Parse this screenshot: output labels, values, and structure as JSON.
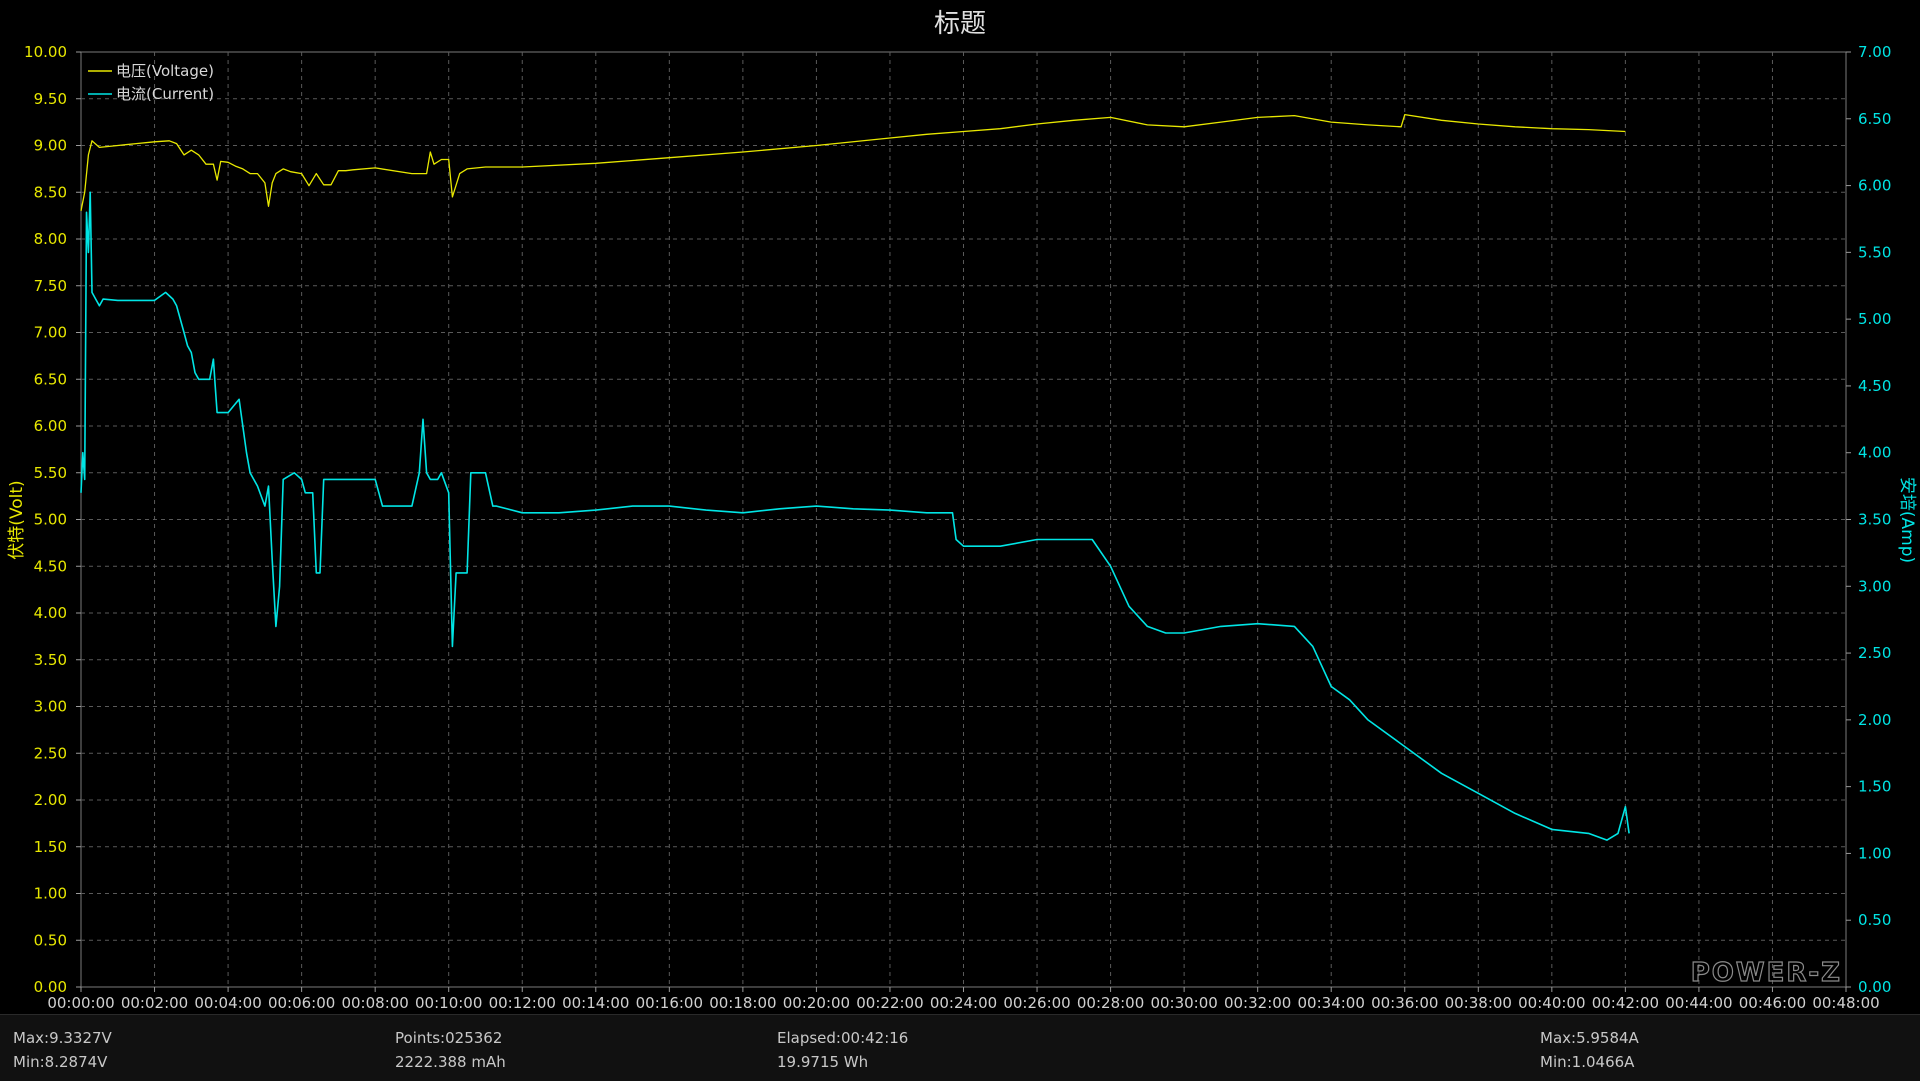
{
  "chart_data": {
    "type": "line",
    "title": "标题",
    "x_label": "",
    "x_range_minutes": [
      0,
      48
    ],
    "x_ticks": [
      "00:00:00",
      "00:02:00",
      "00:04:00",
      "00:06:00",
      "00:08:00",
      "00:10:00",
      "00:12:00",
      "00:14:00",
      "00:16:00",
      "00:18:00",
      "00:20:00",
      "00:22:00",
      "00:24:00",
      "00:26:00",
      "00:28:00",
      "00:30:00",
      "00:32:00",
      "00:34:00",
      "00:36:00",
      "00:38:00",
      "00:40:00",
      "00:42:00",
      "00:44:00",
      "00:46:00",
      "00:48:00"
    ],
    "y_left": {
      "label": "伏特(Volt)",
      "range": [
        0,
        10
      ],
      "ticks": [
        "0.00",
        "0.50",
        "1.00",
        "1.50",
        "2.00",
        "2.50",
        "3.00",
        "3.50",
        "4.00",
        "4.50",
        "5.00",
        "5.50",
        "6.00",
        "6.50",
        "7.00",
        "7.50",
        "8.00",
        "8.50",
        "9.00",
        "9.50",
        "10.00"
      ],
      "color": "#e8e800"
    },
    "y_right": {
      "label": "安培(Amp)",
      "range": [
        0,
        7
      ],
      "ticks": [
        "0.00",
        "0.50",
        "1.00",
        "1.50",
        "2.00",
        "2.50",
        "3.00",
        "3.50",
        "4.00",
        "4.50",
        "5.00",
        "5.50",
        "6.00",
        "6.50",
        "7.00"
      ],
      "color": "#00e5e5"
    },
    "grid": true,
    "legend_position": "top-left",
    "series": [
      {
        "name": "电压(Voltage)",
        "axis": "left",
        "color": "#e8e800",
        "x": [
          0.0,
          0.1,
          0.2,
          0.3,
          0.5,
          1.0,
          1.5,
          2.0,
          2.4,
          2.6,
          2.8,
          3.0,
          3.2,
          3.4,
          3.6,
          3.7,
          3.8,
          4.0,
          4.2,
          4.4,
          4.6,
          4.8,
          5.0,
          5.1,
          5.2,
          5.3,
          5.5,
          5.7,
          6.0,
          6.2,
          6.4,
          6.6,
          6.8,
          7.0,
          7.2,
          7.4,
          8.0,
          9.0,
          9.4,
          9.5,
          9.6,
          9.8,
          10.0,
          10.1,
          10.3,
          10.5,
          11.0,
          12.0,
          14.0,
          16.0,
          18.0,
          20.0,
          22.0,
          23.0,
          24.0,
          25.0,
          26.0,
          27.0,
          28.0,
          29.0,
          30.0,
          31.0,
          32.0,
          33.0,
          34.0,
          35.0,
          35.9,
          36.0,
          37.0,
          38.0,
          39.0,
          40.0,
          41.0,
          42.0
        ],
        "y": [
          8.3,
          8.5,
          8.9,
          9.05,
          8.98,
          9.0,
          9.02,
          9.04,
          9.05,
          9.02,
          8.9,
          8.95,
          8.9,
          8.8,
          8.8,
          8.63,
          8.83,
          8.82,
          8.78,
          8.75,
          8.7,
          8.7,
          8.6,
          8.35,
          8.6,
          8.7,
          8.75,
          8.72,
          8.7,
          8.57,
          8.7,
          8.58,
          8.58,
          8.73,
          8.73,
          8.74,
          8.76,
          8.7,
          8.7,
          8.93,
          8.8,
          8.85,
          8.85,
          8.45,
          8.7,
          8.75,
          8.77,
          8.77,
          8.81,
          8.87,
          8.93,
          9.0,
          9.08,
          9.12,
          9.15,
          9.18,
          9.23,
          9.27,
          9.3,
          9.22,
          9.2,
          9.25,
          9.3,
          9.32,
          9.25,
          9.22,
          9.2,
          9.33,
          9.27,
          9.23,
          9.2,
          9.18,
          9.17,
          9.15
        ]
      },
      {
        "name": "电流(Current)",
        "axis": "right",
        "color": "#00e5e5",
        "x": [
          0.0,
          0.05,
          0.1,
          0.15,
          0.2,
          0.25,
          0.3,
          0.4,
          0.5,
          0.6,
          1.0,
          1.5,
          2.0,
          2.3,
          2.5,
          2.6,
          2.8,
          2.9,
          3.0,
          3.1,
          3.2,
          3.5,
          3.6,
          3.65,
          3.7,
          3.8,
          4.0,
          4.3,
          4.5,
          4.6,
          4.8,
          5.0,
          5.1,
          5.2,
          5.3,
          5.4,
          5.5,
          5.8,
          6.0,
          6.1,
          6.3,
          6.4,
          6.5,
          6.6,
          6.8,
          7.0,
          7.5,
          8.0,
          8.2,
          8.3,
          8.5,
          9.0,
          9.2,
          9.3,
          9.4,
          9.5,
          9.7,
          9.8,
          10.0,
          10.1,
          10.2,
          10.3,
          10.5,
          10.6,
          10.8,
          11.0,
          11.2,
          11.3,
          12.0,
          13.0,
          14.0,
          15.0,
          16.0,
          17.0,
          18.0,
          19.0,
          20.0,
          21.0,
          22.0,
          23.0,
          23.7,
          23.8,
          24.0,
          25.0,
          26.0,
          27.0,
          27.5,
          28.0,
          28.5,
          29.0,
          29.5,
          30.0,
          31.0,
          32.0,
          33.0,
          33.5,
          34.0,
          34.5,
          35.0,
          36.0,
          37.0,
          38.0,
          39.0,
          40.0,
          41.0,
          41.5,
          41.8,
          42.0,
          42.1
        ],
        "y": [
          3.7,
          4.0,
          3.8,
          5.8,
          5.5,
          5.95,
          5.2,
          5.15,
          5.1,
          5.15,
          5.14,
          5.14,
          5.14,
          5.2,
          5.15,
          5.1,
          4.9,
          4.8,
          4.75,
          4.6,
          4.55,
          4.55,
          4.7,
          4.5,
          4.3,
          4.3,
          4.3,
          4.4,
          4.0,
          3.85,
          3.75,
          3.6,
          3.75,
          3.2,
          2.7,
          3.0,
          3.8,
          3.85,
          3.8,
          3.7,
          3.7,
          3.1,
          3.1,
          3.8,
          3.8,
          3.8,
          3.8,
          3.8,
          3.6,
          3.6,
          3.6,
          3.6,
          3.85,
          4.25,
          3.85,
          3.8,
          3.8,
          3.85,
          3.7,
          2.55,
          3.1,
          3.1,
          3.1,
          3.85,
          3.85,
          3.85,
          3.6,
          3.6,
          3.55,
          3.55,
          3.57,
          3.6,
          3.6,
          3.57,
          3.55,
          3.58,
          3.6,
          3.58,
          3.57,
          3.55,
          3.55,
          3.35,
          3.3,
          3.3,
          3.35,
          3.35,
          3.35,
          3.15,
          2.85,
          2.7,
          2.65,
          2.65,
          2.7,
          2.72,
          2.7,
          2.55,
          2.25,
          2.15,
          2.0,
          1.8,
          1.6,
          1.45,
          1.3,
          1.18,
          1.15,
          1.1,
          1.15,
          1.35,
          1.15
        ]
      }
    ],
    "watermark": "POWER-Z"
  },
  "footer": {
    "v_max": "Max:9.3327V",
    "v_min": "Min:8.2874V",
    "points": "Points:025362",
    "capacity": "2222.388 mAh",
    "elapsed": "Elapsed:00:42:16",
    "energy": "19.9715 Wh",
    "a_max": "Max:5.9584A",
    "a_min": "Min:1.0466A"
  }
}
